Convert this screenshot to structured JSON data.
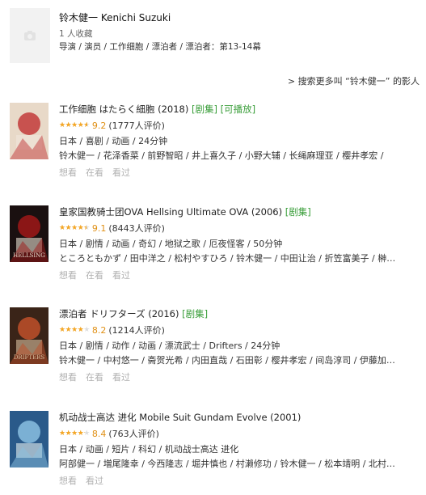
{
  "person": {
    "name": "铃木健一 Kenichi Suzuki",
    "favorites": "1 人收藏",
    "roles": "导演 / 演员 / 工作细胞 / 漂泊者 / 漂泊者：第13-14幕"
  },
  "search_more": "> 搜索更多叫 “铃木健一” 的影人",
  "items": [
    {
      "title": "工作细胞 はたらく細胞 (2018)",
      "tags": [
        "[剧集]",
        "[可播放]"
      ],
      "score": "9.2",
      "rating_fraction": 0.92,
      "count": "(1777人评价)",
      "meta": "日本 / 喜剧 / 动画 / 24分钟",
      "cast": "铃木健一 / 花泽香菜 / 前野智昭 / 井上喜久子 / 小野大辅 / 长绳麻理亚 / 樱井孝宏 /",
      "actions": [
        "想看",
        "在看",
        "看过"
      ],
      "poster_colors": [
        "#e8d9c8",
        "#c23a3a",
        "#f0e6dc"
      ]
    },
    {
      "title": "皇家国教骑士团OVA Hellsing Ultimate OVA (2006)",
      "tags": [
        "[剧集]"
      ],
      "score": "9.1",
      "rating_fraction": 0.91,
      "count": "(8443人评价)",
      "meta": "日本 / 剧情 / 动画 / 奇幻 / 地狱之歌 / 厄夜怪客 / 50分钟",
      "cast": "ところともかず / 田中洋之 / 松村やすひろ / 铃木健一 / 中田让治 / 折笠富美子 / 榊…",
      "actions": [
        "想看",
        "在看",
        "看过"
      ],
      "poster_colors": [
        "#1a1010",
        "#a01818",
        "#e8e0d0"
      ],
      "poster_text": "HELLSING"
    },
    {
      "title": "漂泊者 ドリフターズ (2016)",
      "tags": [
        "[剧集]"
      ],
      "score": "8.2",
      "rating_fraction": 0.82,
      "count": "(1214人评价)",
      "meta": "日本 / 剧情 / 动作 / 动画 / 漂流武士 / Drifters / 24分钟",
      "cast": "铃木健一 / 中村悠一 / 斋贺光希 / 内田直哉 / 石田彰 / 樱井孝宏 / 间岛淳司 / 伊藤加…",
      "actions": [
        "想看",
        "在看",
        "看过"
      ],
      "poster_colors": [
        "#3a2418",
        "#c0502a",
        "#d8c0a0"
      ],
      "poster_text": "DRIFTERS"
    },
    {
      "title": "机动战士高达 进化 Mobile Suit Gundam Evolve (2001)",
      "tags": [],
      "score": "8.4",
      "rating_fraction": 0.84,
      "count": "(763人评价)",
      "meta": "日本 / 动画 / 短片 / 科幻 / 机动战士高达 进化",
      "cast": "阿部健一 / 増尾隆幸 / 今西隆志 / 堀井慎也 / 村濑修功 / 铃木健一 / 松本靖明 / 北村…",
      "actions": [
        "想看",
        "看过"
      ],
      "poster_colors": [
        "#2a5a8a",
        "#8ac0e0",
        "#e8f0f0"
      ]
    }
  ]
}
